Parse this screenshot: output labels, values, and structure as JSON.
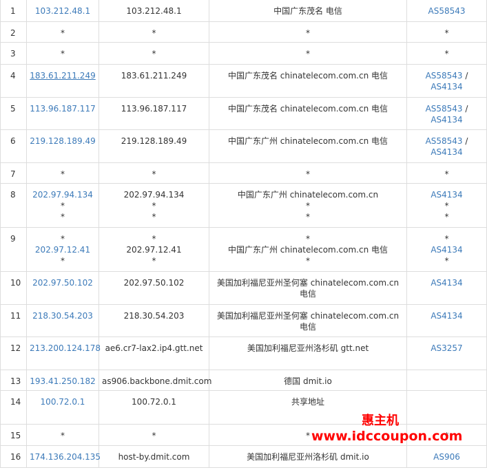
{
  "rows": [
    {
      "hop": "1",
      "ip": [
        "103.212.48.1"
      ],
      "host": [
        "103.212.48.1"
      ],
      "loc": [
        "中国广东茂名 电信"
      ],
      "as": [
        [
          "AS58543"
        ]
      ],
      "h": 32
    },
    {
      "hop": "2",
      "ip": [
        "*"
      ],
      "host": [
        "*"
      ],
      "loc": [
        "*"
      ],
      "as": [
        [
          "*"
        ]
      ],
      "h": 30
    },
    {
      "hop": "3",
      "ip": [
        "*"
      ],
      "host": [
        "*"
      ],
      "loc": [
        "*"
      ],
      "as": [
        [
          "*"
        ]
      ],
      "h": 32
    },
    {
      "hop": "4",
      "ip": [
        "183.61.211.249"
      ],
      "host": [
        "183.61.211.249"
      ],
      "loc": [
        "中国广东茂名 chinatelecom.com.cn 电信"
      ],
      "as": [
        [
          "AS58543",
          "AS4134"
        ]
      ],
      "h": 48
    },
    {
      "hop": "5",
      "ip": [
        "113.96.187.117"
      ],
      "host": [
        "113.96.187.117"
      ],
      "loc": [
        "中国广东茂名 chinatelecom.com.cn 电信"
      ],
      "as": [
        [
          "AS58543",
          "AS4134"
        ]
      ],
      "h": 47
    },
    {
      "hop": "6",
      "ip": [
        "219.128.189.49"
      ],
      "host": [
        "219.128.189.49"
      ],
      "loc": [
        "中国广东广州 chinatelecom.com.cn 电信"
      ],
      "as": [
        [
          "AS58543",
          "AS4134"
        ]
      ],
      "h": 48
    },
    {
      "hop": "7",
      "ip": [
        "*"
      ],
      "host": [
        "*"
      ],
      "loc": [
        "*"
      ],
      "as": [
        [
          "*"
        ]
      ],
      "h": 30
    },
    {
      "hop": "8",
      "ip": [
        "202.97.94.134",
        "*",
        "*"
      ],
      "host": [
        "202.97.94.134",
        "*",
        "*"
      ],
      "loc": [
        "中国广东广州 chinatelecom.com.cn",
        "*",
        "*"
      ],
      "as": [
        [
          "AS4134"
        ],
        [
          "*"
        ],
        [
          "*"
        ]
      ],
      "h": 64
    },
    {
      "hop": "9",
      "ip": [
        "*",
        "202.97.12.41",
        "*"
      ],
      "host": [
        "*",
        "202.97.12.41",
        "*"
      ],
      "loc": [
        "*",
        "中国广东广州 chinatelecom.com.cn 电信",
        "*"
      ],
      "as": [
        [
          "*"
        ],
        [
          "AS4134"
        ],
        [
          "*"
        ]
      ],
      "h": 64
    },
    {
      "hop": "10",
      "ip": [
        "202.97.50.102"
      ],
      "host": [
        "202.97.50.102"
      ],
      "loc": [
        "美国加利福尼亚州圣何塞 chinatelecom.com.cn 电信"
      ],
      "as": [
        [
          "AS4134"
        ]
      ],
      "h": 48
    },
    {
      "hop": "11",
      "ip": [
        "218.30.54.203"
      ],
      "host": [
        "218.30.54.203"
      ],
      "loc": [
        "美国加利福尼亚州圣何塞 chinatelecom.com.cn 电信"
      ],
      "as": [
        [
          "AS4134"
        ]
      ],
      "h": 47
    },
    {
      "hop": "12",
      "ip": [
        "213.200.124.178"
      ],
      "host": [
        "ae6.cr7-lax2.ip4.gtt.net"
      ],
      "loc": [
        "美国加利福尼亚州洛杉矶 gtt.net"
      ],
      "as": [
        [
          "AS3257"
        ]
      ],
      "h": 48
    },
    {
      "hop": "13",
      "ip": [
        "193.41.250.182"
      ],
      "host": [
        "as906.backbone.dmit.com"
      ],
      "loc": [
        "德国 dmit.io"
      ],
      "as": [
        [
          ""
        ]
      ],
      "h": 30
    },
    {
      "hop": "14",
      "ip": [
        "100.72.0.1"
      ],
      "host": [
        "100.72.0.1"
      ],
      "loc": [
        "共享地址"
      ],
      "as": [
        [
          ""
        ]
      ],
      "h": 49
    },
    {
      "hop": "15",
      "ip": [
        "*"
      ],
      "host": [
        "*"
      ],
      "loc": [
        "*"
      ],
      "as": [
        [
          "*"
        ]
      ],
      "h": 31
    },
    {
      "hop": "16",
      "ip": [
        "174.136.204.135"
      ],
      "host": [
        "host-by.dmit.com"
      ],
      "loc": [
        "美国加利福尼亚州洛杉矶 dmit.io"
      ],
      "as": [
        [
          "AS906"
        ]
      ],
      "h": 32
    }
  ],
  "as_separator": "/",
  "watermark": {
    "brand": "惠主机",
    "url": "www.idccoupon.com",
    "color": "#ff0000"
  },
  "colors": {
    "link": "#3c7ab9",
    "border": "#dddddd",
    "text": "#333333"
  }
}
